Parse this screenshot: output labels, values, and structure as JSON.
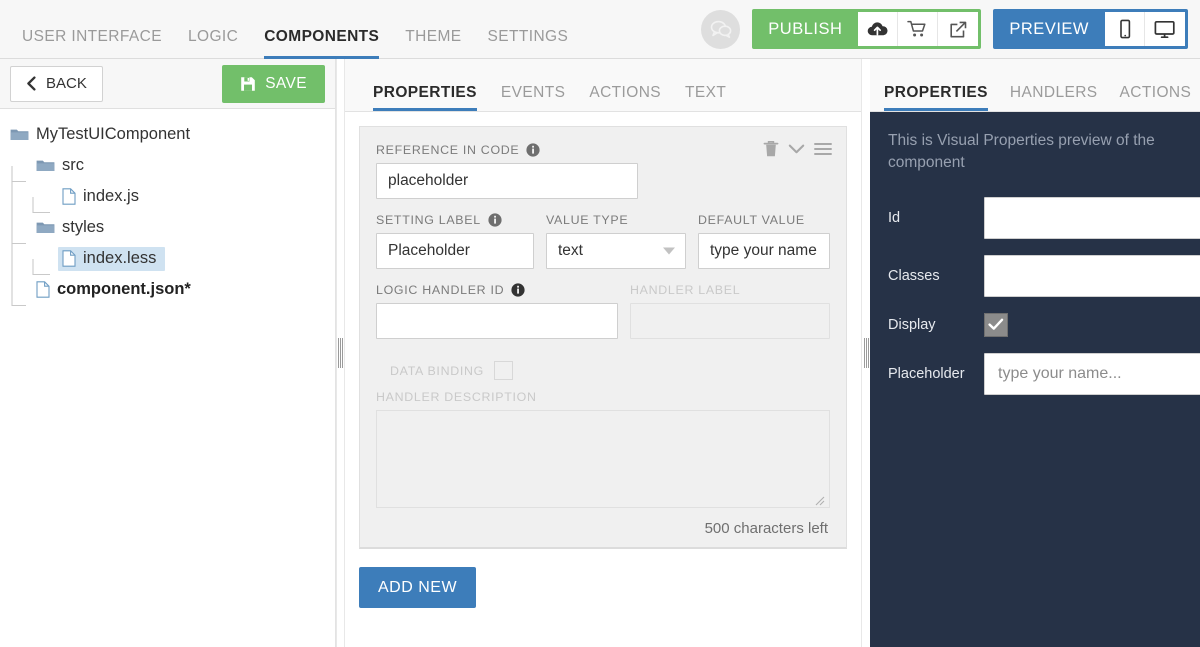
{
  "topbar": {
    "tabs": [
      {
        "label": "USER INTERFACE",
        "active": false
      },
      {
        "label": "LOGIC",
        "active": false
      },
      {
        "label": "COMPONENTS",
        "active": true
      },
      {
        "label": "THEME",
        "active": false
      },
      {
        "label": "SETTINGS",
        "active": false
      }
    ],
    "chat_icon": "chat-bubbles-icon",
    "publish": {
      "label": "PUBLISH",
      "color": "#72bf6a",
      "icons": [
        "cloud-upload-icon",
        "shopping-cart-icon",
        "external-link-icon"
      ]
    },
    "preview": {
      "label": "PREVIEW",
      "color": "#3d7dba",
      "icons": [
        "mobile-icon",
        "desktop-icon"
      ]
    }
  },
  "left": {
    "back_label": "BACK",
    "back_icon": "chevron-left-icon",
    "save_label": "SAVE",
    "save_icon": "floppy-disk-icon",
    "tree": [
      {
        "label": "MyTestUIComponent",
        "type": "folder",
        "depth": 0,
        "selected": false,
        "modified": false
      },
      {
        "label": "src",
        "type": "folder",
        "depth": 1,
        "selected": false,
        "modified": false
      },
      {
        "label": "index.js",
        "type": "file",
        "depth": 2,
        "selected": false,
        "modified": false
      },
      {
        "label": "styles",
        "type": "folder",
        "depth": 1,
        "selected": false,
        "modified": false
      },
      {
        "label": "index.less",
        "type": "file",
        "depth": 2,
        "selected": true,
        "modified": false
      },
      {
        "label": "component.json*",
        "type": "file",
        "depth": 1,
        "selected": false,
        "modified": true
      }
    ]
  },
  "center": {
    "tabs": [
      {
        "label": "PROPERTIES",
        "active": true
      },
      {
        "label": "EVENTS",
        "active": false
      },
      {
        "label": "ACTIONS",
        "active": false
      },
      {
        "label": "TEXT",
        "active": false
      }
    ],
    "card": {
      "tool_icons": [
        "trash-icon",
        "chevron-down-icon",
        "hamburger-menu-icon"
      ],
      "reference_in_code": {
        "label": "REFERENCE IN CODE",
        "value": "placeholder",
        "info": true
      },
      "setting_label": {
        "label": "SETTING LABEL",
        "value": "Placeholder",
        "info": true
      },
      "value_type": {
        "label": "VALUE TYPE",
        "value": "text"
      },
      "default_value": {
        "label": "DEFAULT VALUE",
        "value": "type your name.."
      },
      "logic_handler_id": {
        "label": "LOGIC HANDLER ID",
        "value": "",
        "info": true
      },
      "handler_label": {
        "label": "HANDLER LABEL",
        "value": "",
        "disabled": true
      },
      "data_binding": {
        "label": "DATA BINDING",
        "checked": false,
        "disabled": true
      },
      "handler_description": {
        "label": "HANDLER DESCRIPTION",
        "value": "",
        "disabled": true
      },
      "chars_left": "500 characters left"
    },
    "add_new_label": "ADD NEW"
  },
  "right": {
    "tabs": [
      {
        "label": "PROPERTIES",
        "active": true
      },
      {
        "label": "HANDLERS",
        "active": false
      },
      {
        "label": "ACTIONS",
        "active": false
      }
    ],
    "note": "This is Visual Properties preview of the component",
    "fields": [
      {
        "label": "Id",
        "type": "text",
        "value": "",
        "placeholder": ""
      },
      {
        "label": "Classes",
        "type": "text",
        "value": "",
        "placeholder": ""
      },
      {
        "label": "Display",
        "type": "checkbox",
        "checked": true
      },
      {
        "label": "Placeholder",
        "type": "text",
        "value": "",
        "placeholder": "type your name..."
      }
    ]
  }
}
